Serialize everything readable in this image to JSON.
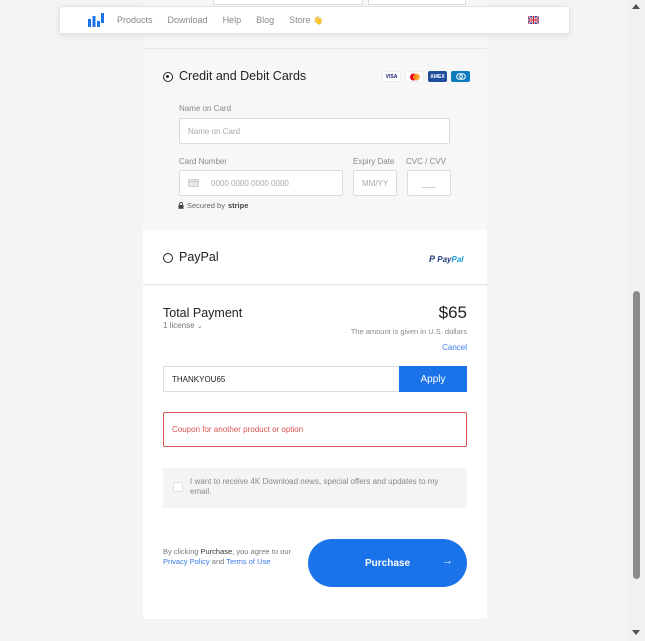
{
  "nav": {
    "links": [
      "Products",
      "Download",
      "Help",
      "Blog",
      "Store"
    ],
    "store_badge": "👋",
    "logo_icon": "bar-chart-logo",
    "flag_icon": "uk-flag-icon"
  },
  "payment": {
    "card_title": "Credit and Debit Cards",
    "card_logos": [
      "VISA",
      "MC",
      "AMEX",
      "DC"
    ],
    "name_label": "Name on Card",
    "name_placeholder": "Name on Card",
    "number_label": "Card Number",
    "number_placeholder": "0000 0000 0000 0000",
    "expiry_label": "Expiry Date",
    "expiry_placeholder": "MM/YY",
    "cvc_label": "CVC / CVV",
    "cvc_placeholder": "___",
    "secured_text": "Secured by",
    "secured_brand": "stripe",
    "paypal_title": "PayPal",
    "paypal_logo_a": "Pay",
    "paypal_logo_b": "Pal"
  },
  "total": {
    "title": "Total Payment",
    "license": "1 license",
    "price": "$65",
    "note": "The amount is given in U.S. dollars",
    "cancel": "Cancel",
    "coupon_value": "THANKYOU65",
    "apply_label": "Apply",
    "error": "Coupon for another product or option",
    "newsletter": "I want to receive 4K Download news, special offers and updates to my email.",
    "terms_a": "By clicking ",
    "terms_b": "Purchase",
    "terms_c": ", you agree to our ",
    "privacy": "Privacy Policy",
    "and": " and ",
    "tos": "Terms of Use",
    "purchase_label": "Purchase",
    "purchase_arrow": "→"
  },
  "colors": {
    "accent": "#1a73e8",
    "error": "#d9534f",
    "link": "#3a78e8"
  }
}
